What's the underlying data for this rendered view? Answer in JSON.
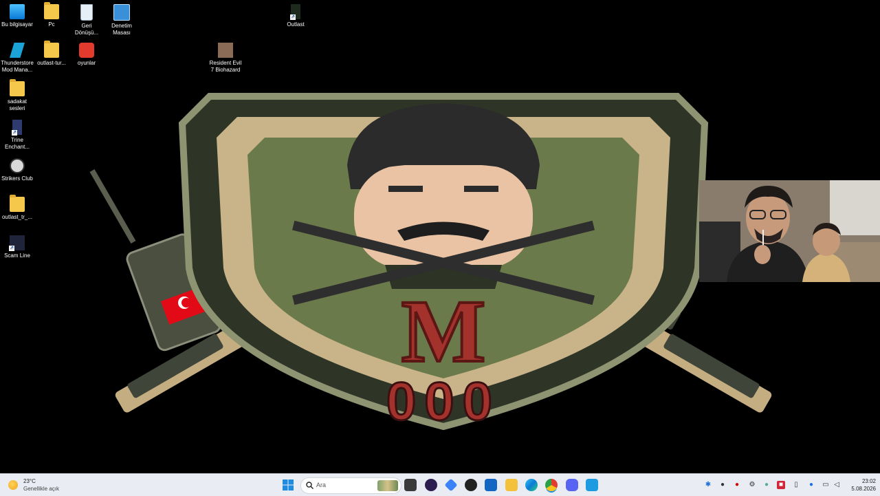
{
  "desktop_icons": [
    {
      "label": "Bu bilgisayar"
    },
    {
      "label": "Pc"
    },
    {
      "label": "Geri Dönüşü..."
    },
    {
      "label": "Denetim Masası"
    },
    {
      "label": "Outlast"
    },
    {
      "label": "Thunderstore Mod Mana..."
    },
    {
      "label": "outlast-tur..."
    },
    {
      "label": "oyunlar"
    },
    {
      "label": "Resident Evil 7 Biohazard"
    },
    {
      "label": "sadakat sesleri"
    },
    {
      "label": "Trine Enchant..."
    },
    {
      "label": "Strikers Club"
    },
    {
      "label": "outlast_tr_..."
    },
    {
      "label": "Scam Line"
    }
  ],
  "wallpaper": {
    "letter": "M",
    "number": "000",
    "colors": {
      "shield": "#6b7a4b",
      "letter": "#a3312c",
      "camo": "#c9b48a"
    }
  },
  "taskbar": {
    "weather": {
      "temp": "23°C",
      "desc": "Genellikle açık"
    },
    "search_placeholder": "Ara",
    "clock": {
      "time": "23:02",
      "date": "5.08.2026"
    }
  }
}
